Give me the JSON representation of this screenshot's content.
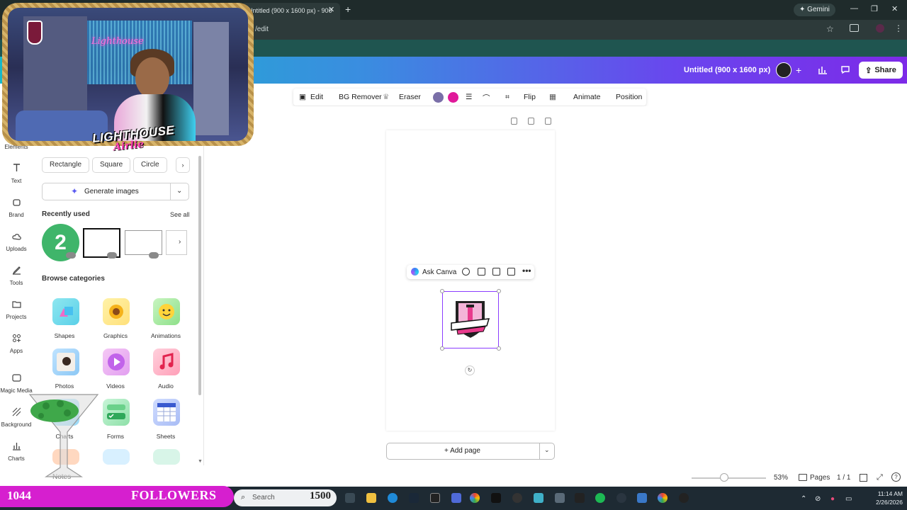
{
  "browser": {
    "tab_title": "Untitled (900 x 1600 px) - 900",
    "url": "/edit",
    "gemini_label": "Gemini"
  },
  "header": {
    "doc_title": "Untitled (900 x 1600 px)",
    "share_label": "Share"
  },
  "toolbar": {
    "edit": "Edit",
    "bg_remover": "BG Remover",
    "eraser": "Eraser",
    "flip": "Flip",
    "animate": "Animate",
    "position": "Position",
    "swatch_colors": [
      "#7a6fa8",
      "#e0199a"
    ]
  },
  "rail": {
    "items": [
      {
        "label": "Elements",
        "icon": "shapes-icon"
      },
      {
        "label": "Text",
        "icon": "text-icon"
      },
      {
        "label": "Brand",
        "icon": "brand-icon"
      },
      {
        "label": "Uploads",
        "icon": "upload-icon"
      },
      {
        "label": "Tools",
        "icon": "pen-icon"
      },
      {
        "label": "Projects",
        "icon": "folder-icon"
      },
      {
        "label": "Apps",
        "icon": "apps-icon"
      },
      {
        "label": "Magic Media",
        "icon": "magic-icon"
      },
      {
        "label": "Background",
        "icon": "pattern-icon"
      },
      {
        "label": "Charts",
        "icon": "chart-icon"
      }
    ]
  },
  "panel": {
    "shape_chips": [
      "Rectangle",
      "Square",
      "Circle"
    ],
    "generate_label": "Generate images",
    "recently_used": "Recently used",
    "see_all": "See all",
    "recent_number": "2",
    "browse_categories": "Browse categories",
    "categories": [
      "Shapes",
      "Graphics",
      "Animations",
      "Photos",
      "Videos",
      "Audio",
      "Charts",
      "Forms",
      "Sheets"
    ],
    "notes": "Notes"
  },
  "canvas": {
    "ask_canva": "Ask Canva",
    "add_page": "+ Add page"
  },
  "footer": {
    "zoom": "53%",
    "pages_label": "Pages",
    "page_count": "1 / 1",
    "zoom_level": 0.53
  },
  "stream": {
    "followers_count": "1044",
    "followers_label": "FOLLOWERS",
    "followers_goal": "1500",
    "neon_sign": "Lighthouse",
    "badge_line1": "LIGHTHOUSE",
    "badge_line2": "Airlie"
  },
  "taskbar": {
    "search_placeholder": "Search",
    "time": "11:14 AM",
    "date": "2/26/2026"
  }
}
